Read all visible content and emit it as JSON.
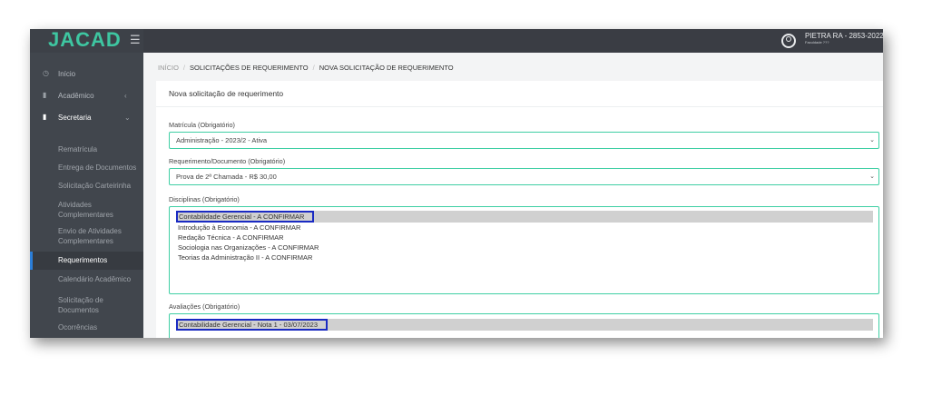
{
  "brand": {
    "logo_text": "JACAD"
  },
  "header": {
    "user_name": "PIETRA RA - 2853-2022",
    "user_sub": "Faculdade ???"
  },
  "sidebar": {
    "items": [
      {
        "label": "Início",
        "icon": "clock-icon"
      },
      {
        "label": "Acadêmico",
        "icon": "folder-icon"
      },
      {
        "label": "Secretaria",
        "icon": "file-icon"
      }
    ],
    "secretaria_items": [
      "Rematrícula",
      "Entrega de Documentos",
      "Solicitação Carteirinha",
      "Atividades Complementares",
      "Envio de Atividades Complementares",
      "Requerimentos",
      "Calendário Acadêmico",
      "Solicitação de Documentos",
      "Ocorrências"
    ],
    "active_item": "Requerimentos"
  },
  "breadcrumb": [
    "INÍCIO",
    "SOLICITAÇÕES DE REQUERIMENTO",
    "NOVA SOLICITAÇÃO DE REQUERIMENTO"
  ],
  "form": {
    "title": "Nova solicitação de requerimento",
    "matricula": {
      "label": "Matrícula (Obrigatório)",
      "value": "Administração - 2023/2 - Ativa"
    },
    "requerimento": {
      "label": "Requerimento/Documento (Obrigatório)",
      "value": "Prova de 2ª Chamada - R$ 30,00"
    },
    "disciplinas": {
      "label": "Disciplinas (Obrigatório)",
      "options": [
        "Contabilidade Gerencial - A CONFIRMAR",
        "Introdução à Economia - A CONFIRMAR",
        "Redação Técnica - A CONFIRMAR",
        "Sociologia nas Organizações - A CONFIRMAR",
        "Teorias da Administração II - A CONFIRMAR"
      ],
      "selected_index": 0
    },
    "avaliacoes": {
      "label": "Avaliações (Obrigatório)",
      "options": [
        "Contabilidade Gerencial - Nota 1 - 03/07/2023"
      ],
      "selected_index": 0
    }
  },
  "colors": {
    "accent": "#3ec6a1",
    "field_border": "#3fcfa4",
    "highlight": "#1a2ac2",
    "sidebar": "#41464d"
  }
}
